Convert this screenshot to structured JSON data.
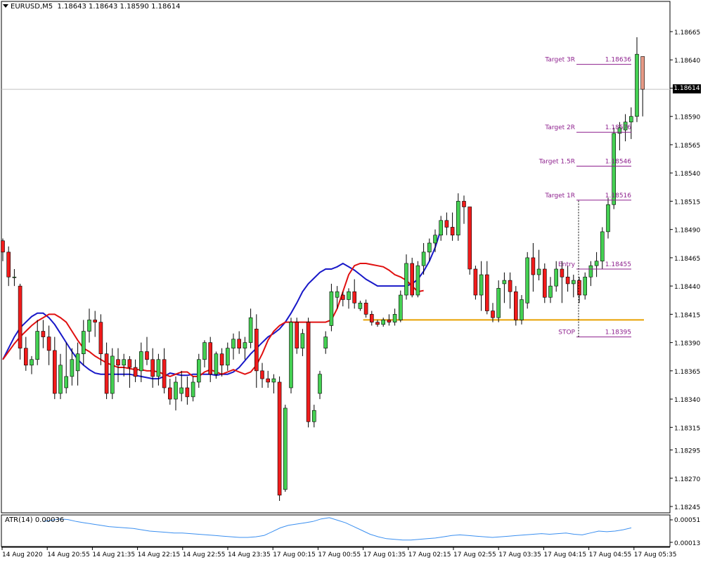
{
  "header": {
    "symbol": "EURUSD,M5",
    "ohlc": "1.18643 1.18643 1.18590 1.18614"
  },
  "current_price": "1.18614",
  "atr_panel": {
    "label": "ATR(14) 0.00036",
    "scale_labels": [
      "0.00051",
      "0.00013"
    ]
  },
  "colors": {
    "bull": "#44d052",
    "bear": "#f11b1b",
    "ma_fast": "#e01010",
    "ma_slow": "#1818c8",
    "level": "#e8a000",
    "annotation": "#8d1f8d",
    "atr": "#3a8ff0"
  },
  "chart_data": {
    "type": "candlestick",
    "price_axis": {
      "range": [
        1.18235,
        1.1868
      ],
      "ticks": [
        "1.18665",
        "1.18640",
        "1.18615",
        "1.18590",
        "1.18565",
        "1.18540",
        "1.18515",
        "1.18490",
        "1.18465",
        "1.18440",
        "1.18415",
        "1.18390",
        "1.18365",
        "1.18340",
        "1.18315",
        "1.18295",
        "1.18270",
        "1.18245"
      ]
    },
    "time_axis": {
      "labels": [
        "14 Aug 2020",
        "14 Aug 20:55",
        "14 Aug 21:35",
        "14 Aug 22:15",
        "14 Aug 22:55",
        "14 Aug 23:35",
        "17 Aug 00:15",
        "17 Aug 00:55",
        "17 Aug 01:35",
        "17 Aug 02:15",
        "17 Aug 02:55",
        "17 Aug 03:35",
        "17 Aug 04:15",
        "17 Aug 04:55",
        "17 Aug 05:35"
      ]
    },
    "candles": [
      [
        1.1848,
        1.18482,
        1.18462,
        1.1847
      ],
      [
        1.1847,
        1.18475,
        1.1844,
        1.18448
      ],
      [
        1.18448,
        1.18455,
        1.1844,
        1.18448
      ],
      [
        1.1844,
        1.18442,
        1.18375,
        1.18385
      ],
      [
        1.18385,
        1.18395,
        1.18365,
        1.1837
      ],
      [
        1.1837,
        1.18378,
        1.18362,
        1.18375
      ],
      [
        1.18375,
        1.1841,
        1.1837,
        1.184
      ],
      [
        1.184,
        1.1841,
        1.18385,
        1.18395
      ],
      [
        1.18395,
        1.18405,
        1.1837,
        1.18383
      ],
      [
        1.18383,
        1.18395,
        1.1834,
        1.18345
      ],
      [
        1.18345,
        1.1838,
        1.1834,
        1.1837
      ],
      [
        1.1835,
        1.1839,
        1.18345,
        1.1836
      ],
      [
        1.1836,
        1.18385,
        1.18352,
        1.18375
      ],
      [
        1.18365,
        1.1839,
        1.18352,
        1.1838
      ],
      [
        1.1838,
        1.1841,
        1.1837,
        1.184
      ],
      [
        1.184,
        1.1842,
        1.1839,
        1.1841
      ],
      [
        1.1841,
        1.18418,
        1.18395,
        1.18408
      ],
      [
        1.18408,
        1.18415,
        1.1837,
        1.1838
      ],
      [
        1.1838,
        1.1839,
        1.1834,
        1.18345
      ],
      [
        1.18345,
        1.18385,
        1.1834,
        1.18378
      ],
      [
        1.18375,
        1.18385,
        1.18355,
        1.1837
      ],
      [
        1.1837,
        1.1838,
        1.1836,
        1.18375
      ],
      [
        1.18375,
        1.18378,
        1.1835,
        1.18368
      ],
      [
        1.18368,
        1.18375,
        1.18355,
        1.1836
      ],
      [
        1.18365,
        1.1839,
        1.18355,
        1.18382
      ],
      [
        1.18382,
        1.18395,
        1.1837,
        1.18375
      ],
      [
        1.18375,
        1.18385,
        1.1835,
        1.1836
      ],
      [
        1.1836,
        1.1838,
        1.18352,
        1.18375
      ],
      [
        1.18375,
        1.18385,
        1.18345,
        1.1835
      ],
      [
        1.1835,
        1.18358,
        1.18335,
        1.1834
      ],
      [
        1.1834,
        1.1836,
        1.1833,
        1.18355
      ],
      [
        1.18345,
        1.18365,
        1.18338,
        1.1835
      ],
      [
        1.1835,
        1.1836,
        1.18335,
        1.18342
      ],
      [
        1.18342,
        1.1836,
        1.18338,
        1.18355
      ],
      [
        1.18355,
        1.1838,
        1.1835,
        1.18375
      ],
      [
        1.18375,
        1.18392,
        1.18368,
        1.1839
      ],
      [
        1.1839,
        1.18395,
        1.18355,
        1.18362
      ],
      [
        1.18362,
        1.18382,
        1.18358,
        1.1838
      ],
      [
        1.1838,
        1.18385,
        1.1836,
        1.1837
      ],
      [
        1.1837,
        1.1839,
        1.18365,
        1.18385
      ],
      [
        1.18385,
        1.18398,
        1.18375,
        1.18393
      ],
      [
        1.18393,
        1.184,
        1.1838,
        1.18385
      ],
      [
        1.18385,
        1.18395,
        1.18375,
        1.1839
      ],
      [
        1.1839,
        1.1842,
        1.18385,
        1.18412
      ],
      [
        1.18402,
        1.18415,
        1.1835,
        1.18365
      ],
      [
        1.18365,
        1.18372,
        1.1835,
        1.18358
      ],
      [
        1.18358,
        1.18365,
        1.1835,
        1.18355
      ],
      [
        1.18355,
        1.18362,
        1.18345,
        1.18358
      ],
      [
        1.18355,
        1.1836,
        1.1825,
        1.18255
      ],
      [
        1.1826,
        1.18335,
        1.18258,
        1.18332
      ],
      [
        1.1835,
        1.18412,
        1.18345,
        1.18408
      ],
      [
        1.18408,
        1.18412,
        1.1838,
        1.18385
      ],
      [
        1.18385,
        1.18402,
        1.18378,
        1.18398
      ],
      [
        1.18408,
        1.18412,
        1.18315,
        1.1832
      ],
      [
        1.1832,
        1.18335,
        1.18315,
        1.1833
      ],
      [
        1.18345,
        1.18365,
        1.1834,
        1.18362
      ],
      [
        1.18385,
        1.184,
        1.1838,
        1.18395
      ],
      [
        1.18405,
        1.18442,
        1.184,
        1.18435
      ],
      [
        1.1843,
        1.1844,
        1.1842,
        1.18435
      ],
      [
        1.18432,
        1.18435,
        1.18422,
        1.18428
      ],
      [
        1.18428,
        1.18438,
        1.1842,
        1.18435
      ],
      [
        1.18435,
        1.18446,
        1.1842,
        1.18425
      ],
      [
        1.1842,
        1.18427,
        1.18418,
        1.18425
      ],
      [
        1.18425,
        1.18428,
        1.18412,
        1.18415
      ],
      [
        1.18415,
        1.18418,
        1.18405,
        1.18408
      ],
      [
        1.18408,
        1.1841,
        1.18404,
        1.18406
      ],
      [
        1.18406,
        1.18412,
        1.18404,
        1.1841
      ],
      [
        1.1841,
        1.18415,
        1.18405,
        1.18408
      ],
      [
        1.18408,
        1.1842,
        1.18405,
        1.18415
      ],
      [
        1.1841,
        1.18436,
        1.18408,
        1.18432
      ],
      [
        1.18432,
        1.18468,
        1.18428,
        1.1846
      ],
      [
        1.1846,
        1.18465,
        1.1843,
        1.18432
      ],
      [
        1.18432,
        1.18462,
        1.1843,
        1.18458
      ],
      [
        1.18458,
        1.18478,
        1.1845,
        1.1847
      ],
      [
        1.1847,
        1.18482,
        1.18462,
        1.18478
      ],
      [
        1.18478,
        1.1849,
        1.1847,
        1.18485
      ],
      [
        1.18485,
        1.18502,
        1.1848,
        1.18498
      ],
      [
        1.18498,
        1.18505,
        1.18485,
        1.18492
      ],
      [
        1.18492,
        1.18505,
        1.1848,
        1.18485
      ],
      [
        1.18485,
        1.18522,
        1.1848,
        1.18515
      ],
      [
        1.18515,
        1.1852,
        1.18495,
        1.1851
      ],
      [
        1.1851,
        1.1851,
        1.1845,
        1.18455
      ],
      [
        1.18455,
        1.18458,
        1.18428,
        1.18432
      ],
      [
        1.18432,
        1.18462,
        1.18418,
        1.1845
      ],
      [
        1.1845,
        1.18462,
        1.18415,
        1.18418
      ],
      [
        1.18418,
        1.18425,
        1.18408,
        1.18412
      ],
      [
        1.18412,
        1.18445,
        1.18408,
        1.18438
      ],
      [
        1.18442,
        1.18452,
        1.18425,
        1.18445
      ],
      [
        1.18445,
        1.18452,
        1.1842,
        1.18435
      ],
      [
        1.18435,
        1.1844,
        1.18405,
        1.1841
      ],
      [
        1.1841,
        1.18432,
        1.18406,
        1.18428
      ],
      [
        1.18425,
        1.1847,
        1.1842,
        1.18465
      ],
      [
        1.18465,
        1.18478,
        1.18435,
        1.1845
      ],
      [
        1.1845,
        1.18472,
        1.18445,
        1.18455
      ],
      [
        1.18455,
        1.1846,
        1.18425,
        1.1843
      ],
      [
        1.1843,
        1.18448,
        1.18425,
        1.1844
      ],
      [
        1.1844,
        1.18462,
        1.18435,
        1.18455
      ],
      [
        1.18455,
        1.18462,
        1.18425,
        1.18448
      ],
      [
        1.18448,
        1.18458,
        1.18435,
        1.18442
      ],
      [
        1.18442,
        1.1845,
        1.1843,
        1.18445
      ],
      [
        1.18445,
        1.18448,
        1.18425,
        1.18432
      ],
      [
        1.18432,
        1.18452,
        1.18428,
        1.18448
      ],
      [
        1.18448,
        1.18462,
        1.1844,
        1.18458
      ],
      [
        1.18458,
        1.1847,
        1.18448,
        1.18462
      ],
      [
        1.18462,
        1.18492,
        1.18455,
        1.18488
      ],
      [
        1.18488,
        1.18518,
        1.18482,
        1.18512
      ],
      [
        1.18512,
        1.1858,
        1.18508,
        1.18575
      ],
      [
        1.18575,
        1.18585,
        1.1856,
        1.1858
      ],
      [
        1.18578,
        1.18592,
        1.18568,
        1.18585
      ],
      [
        1.18585,
        1.18598,
        1.1857,
        1.1859
      ],
      [
        1.1859,
        1.1866,
        1.18585,
        1.18645
      ],
      [
        1.18643,
        1.18643,
        1.1859,
        1.18614
      ]
    ],
    "ma_fast": [
      1.18375,
      1.18382,
      1.18389,
      1.18395,
      1.184,
      1.18405,
      1.18409,
      1.18412,
      1.18415,
      1.18415,
      1.18412,
      1.18408,
      1.184,
      1.18392,
      1.18385,
      1.18382,
      1.18378,
      1.18375,
      1.18372,
      1.1837,
      1.18368,
      1.18368,
      1.18367,
      1.18366,
      1.18366,
      1.18365,
      1.18365,
      1.18364,
      1.18362,
      1.1836,
      1.18362,
      1.18364,
      1.18364,
      1.1836,
      1.1836,
      1.18364,
      1.18366,
      1.18364,
      1.18362,
      1.18364,
      1.18366,
      1.18364,
      1.18362,
      1.18364,
      1.1837,
      1.1838,
      1.18392,
      1.184,
      1.18405,
      1.18408,
      1.18408,
      1.18408,
      1.18408,
      1.18408,
      1.18408,
      1.18408,
      1.18408,
      1.1841,
      1.1842,
      1.18435,
      1.1845,
      1.18458,
      1.1846,
      1.1846,
      1.18459,
      1.18458,
      1.18457,
      1.18454,
      1.1845,
      1.18448,
      1.18445,
      1.1844,
      1.18435,
      1.18436
    ],
    "ma_slow": [
      1.18375,
      1.18385,
      1.18395,
      1.18403,
      1.18408,
      1.18413,
      1.18416,
      1.18416,
      1.18412,
      1.18406,
      1.18398,
      1.1839,
      1.18382,
      1.18375,
      1.1837,
      1.18366,
      1.18363,
      1.18362,
      1.18362,
      1.18362,
      1.18362,
      1.18362,
      1.18362,
      1.18361,
      1.1836,
      1.18359,
      1.18358,
      1.18358,
      1.1836,
      1.18363,
      1.18362,
      1.18361,
      1.18361,
      1.18362,
      1.18362,
      1.18362,
      1.18362,
      1.18361,
      1.18362,
      1.18362,
      1.18364,
      1.18368,
      1.18374,
      1.1838,
      1.18385,
      1.1839,
      1.18395,
      1.18398,
      1.18402,
      1.18408,
      1.18416,
      1.18425,
      1.18435,
      1.18442,
      1.18447,
      1.18452,
      1.18455,
      1.18455,
      1.18457,
      1.1846,
      1.18457,
      1.18454,
      1.1845,
      1.18446,
      1.18443,
      1.1844,
      1.1844,
      1.1844,
      1.1844,
      1.1844,
      1.1844,
      1.18442,
      1.18446,
      1.18453,
      1.18462,
      1.18474,
      1.1849
    ],
    "horizontal_level": {
      "price": 1.1841
    },
    "annotations": [
      {
        "label": "Target 3R",
        "value_text": "1.18636",
        "price": 1.18636
      },
      {
        "label": "Target 2R",
        "value_text": "1.18576",
        "price": 1.18576
      },
      {
        "label": "Target 1.5R",
        "value_text": "1.18546",
        "price": 1.18546
      },
      {
        "label": "Target 1R",
        "value_text": "1.18516",
        "price": 1.18516
      },
      {
        "label": "Entry",
        "value_text": "1.18455",
        "price": 1.18455
      },
      {
        "label": "STOP",
        "value_text": "1.18395",
        "price": 1.18395
      }
    ],
    "atr_values": [
      0.00046,
      0.00048,
      0.0005,
      0.00049,
      0.00046,
      0.00044,
      0.00042,
      0.0004,
      0.00038,
      0.00037,
      0.00036,
      0.00035,
      0.00033,
      0.00031,
      0.0003,
      0.00029,
      0.00028,
      0.00028,
      0.00027,
      0.00026,
      0.00025,
      0.00024,
      0.00023,
      0.00022,
      0.00021,
      0.00021,
      0.00022,
      0.00024,
      0.0003,
      0.00036,
      0.0004,
      0.00042,
      0.00044,
      0.00046,
      0.0005,
      0.00052,
      0.00048,
      0.00044,
      0.00038,
      0.00032,
      0.00026,
      0.00022,
      0.00019,
      0.00018,
      0.00017,
      0.00017,
      0.00018,
      0.00019,
      0.0002,
      0.00022,
      0.00024,
      0.00025,
      0.00024,
      0.00023,
      0.00022,
      0.00021,
      0.00022,
      0.00023,
      0.00024,
      0.00025,
      0.00026,
      0.00027,
      0.00026,
      0.00027,
      0.00028,
      0.00026,
      0.00025,
      0.00028,
      0.00031,
      0.0003,
      0.00031,
      0.00033,
      0.00036
    ]
  }
}
